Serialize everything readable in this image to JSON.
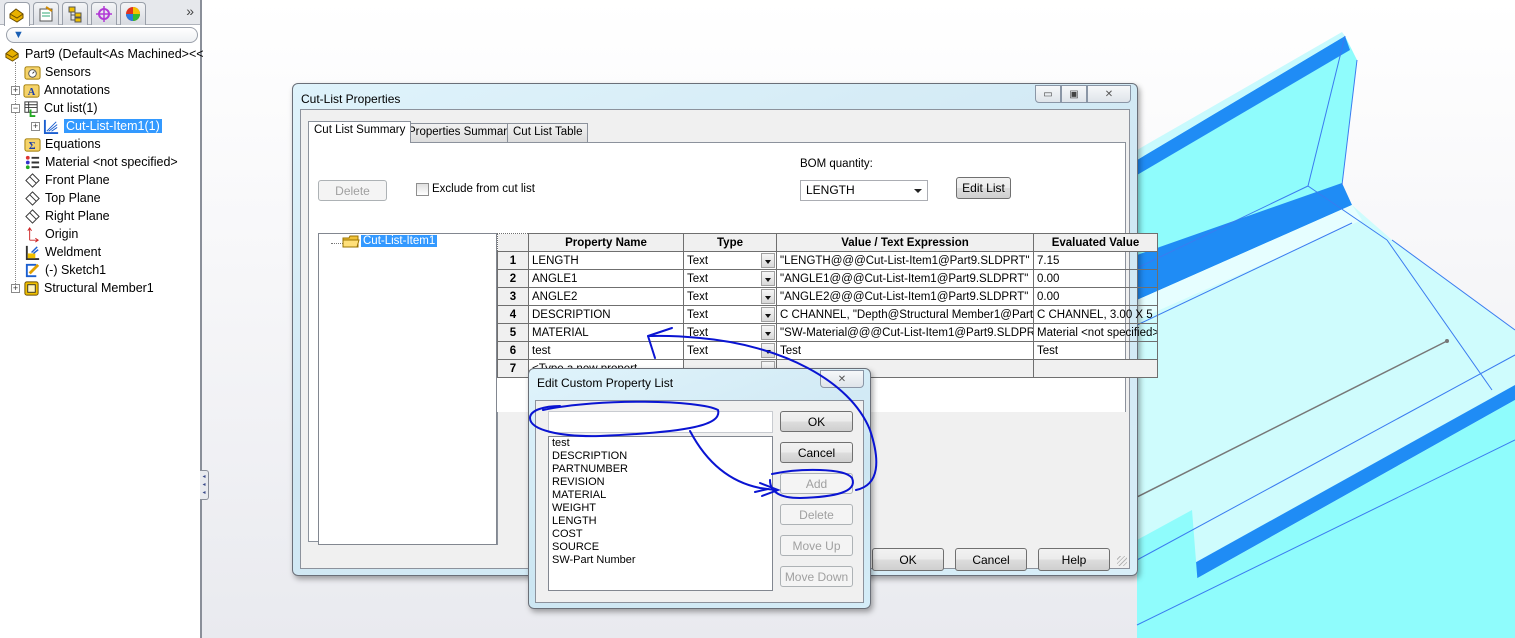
{
  "feature_manager": {
    "tabs": [
      {
        "icon": "feature-manager-icon",
        "active": true
      },
      {
        "icon": "property-manager-icon",
        "active": false
      },
      {
        "icon": "configuration-manager-icon",
        "active": false
      },
      {
        "icon": "dimxpert-manager-icon",
        "active": false
      },
      {
        "icon": "display-manager-icon",
        "active": false
      }
    ],
    "more_label": "»",
    "filter_icon": "filter-icon",
    "root_label": "Part9  (Default<As Machined><<",
    "items": [
      {
        "label": "Sensors",
        "icon": "sensors-icon",
        "expander": ""
      },
      {
        "label": "Annotations",
        "icon": "annotations-icon",
        "expander": "+"
      },
      {
        "label": "Cut list(1)",
        "icon": "cut-list-icon",
        "expander": "−"
      },
      {
        "label": "Cut-List-Item1(1)",
        "icon": "cut-list-item-icon",
        "expander": "+",
        "selected": true
      },
      {
        "label": "Equations",
        "icon": "equations-icon",
        "expander": ""
      },
      {
        "label": "Material <not specified>",
        "icon": "material-icon",
        "expander": ""
      },
      {
        "label": "Front Plane",
        "icon": "plane-icon",
        "expander": ""
      },
      {
        "label": "Top Plane",
        "icon": "plane-icon",
        "expander": ""
      },
      {
        "label": "Right Plane",
        "icon": "plane-icon",
        "expander": ""
      },
      {
        "label": "Origin",
        "icon": "origin-icon",
        "expander": ""
      },
      {
        "label": "Weldment",
        "icon": "weldment-icon",
        "expander": ""
      },
      {
        "label": "(-) Sketch1",
        "icon": "sketch-icon",
        "expander": ""
      },
      {
        "label": "Structural Member1",
        "icon": "structural-member-icon",
        "expander": "+"
      }
    ]
  },
  "cut_list_dialog": {
    "title": "Cut-List Properties",
    "caption_buttons": {
      "minimize": "▭",
      "restore": "▣",
      "close": "✕"
    },
    "tabs": [
      {
        "label": "Cut List Summary",
        "active": true
      },
      {
        "label": "Properties Summary",
        "active": false
      },
      {
        "label": "Cut List Table",
        "active": false
      }
    ],
    "delete_label": "Delete",
    "exclude_label": "Exclude from cut list",
    "exclude_checked": false,
    "bom_quantity_label": "BOM quantity:",
    "bom_quantity_value": "LENGTH",
    "edit_list_label": "Edit List",
    "tree_item": "Cut-List-Item1",
    "grid": {
      "columns": [
        "",
        "Property Name",
        "Type",
        "Value / Text Expression",
        "Evaluated Value"
      ],
      "rows": [
        {
          "num": "1",
          "name": "LENGTH",
          "type": "Text",
          "value": "\"LENGTH@@@Cut-List-Item1@Part9.SLDPRT\"",
          "evaluated": "7.15"
        },
        {
          "num": "2",
          "name": "ANGLE1",
          "type": "Text",
          "value": "\"ANGLE1@@@Cut-List-Item1@Part9.SLDPRT\"",
          "evaluated": "0.00"
        },
        {
          "num": "3",
          "name": "ANGLE2",
          "type": "Text",
          "value": "\"ANGLE2@@@Cut-List-Item1@Part9.SLDPRT\"",
          "evaluated": "0.00"
        },
        {
          "num": "4",
          "name": "DESCRIPTION",
          "type": "Text",
          "value": " C CHANNEL, \"Depth@Structural Member1@Part",
          "evaluated": " C CHANNEL, 3.00 X 5"
        },
        {
          "num": "5",
          "name": "MATERIAL",
          "type": "Text",
          "value": "\"SW-Material@@@Cut-List-Item1@Part9.SLDPR",
          "evaluated": "Material <not specified>"
        },
        {
          "num": "6",
          "name": "test",
          "type": "Text",
          "value": "Test",
          "evaluated": "Test"
        },
        {
          "num": "7",
          "name": "<Type a new propert",
          "type": "",
          "value": "",
          "evaluated": ""
        }
      ]
    },
    "ok_label": "OK",
    "cancel_label": "Cancel",
    "help_label": "Help"
  },
  "edit_property_dialog": {
    "title": "Edit Custom Property List",
    "close_label": "✕",
    "input_value": "",
    "list_items": [
      "test",
      "DESCRIPTION",
      "PARTNUMBER",
      "REVISION",
      "MATERIAL",
      "WEIGHT",
      "LENGTH",
      "COST",
      "SOURCE",
      "SW-Part Number"
    ],
    "ok_label": "OK",
    "cancel_label": "Cancel",
    "add_label": "Add",
    "delete_label": "Delete",
    "move_up_label": "Move Up",
    "move_down_label": "Move Down"
  },
  "colors": {
    "selection": "#3399ff",
    "annotation_ink": "#0a14d2",
    "model_face": "#c9fbfd",
    "model_edge": "#1e88ff"
  }
}
